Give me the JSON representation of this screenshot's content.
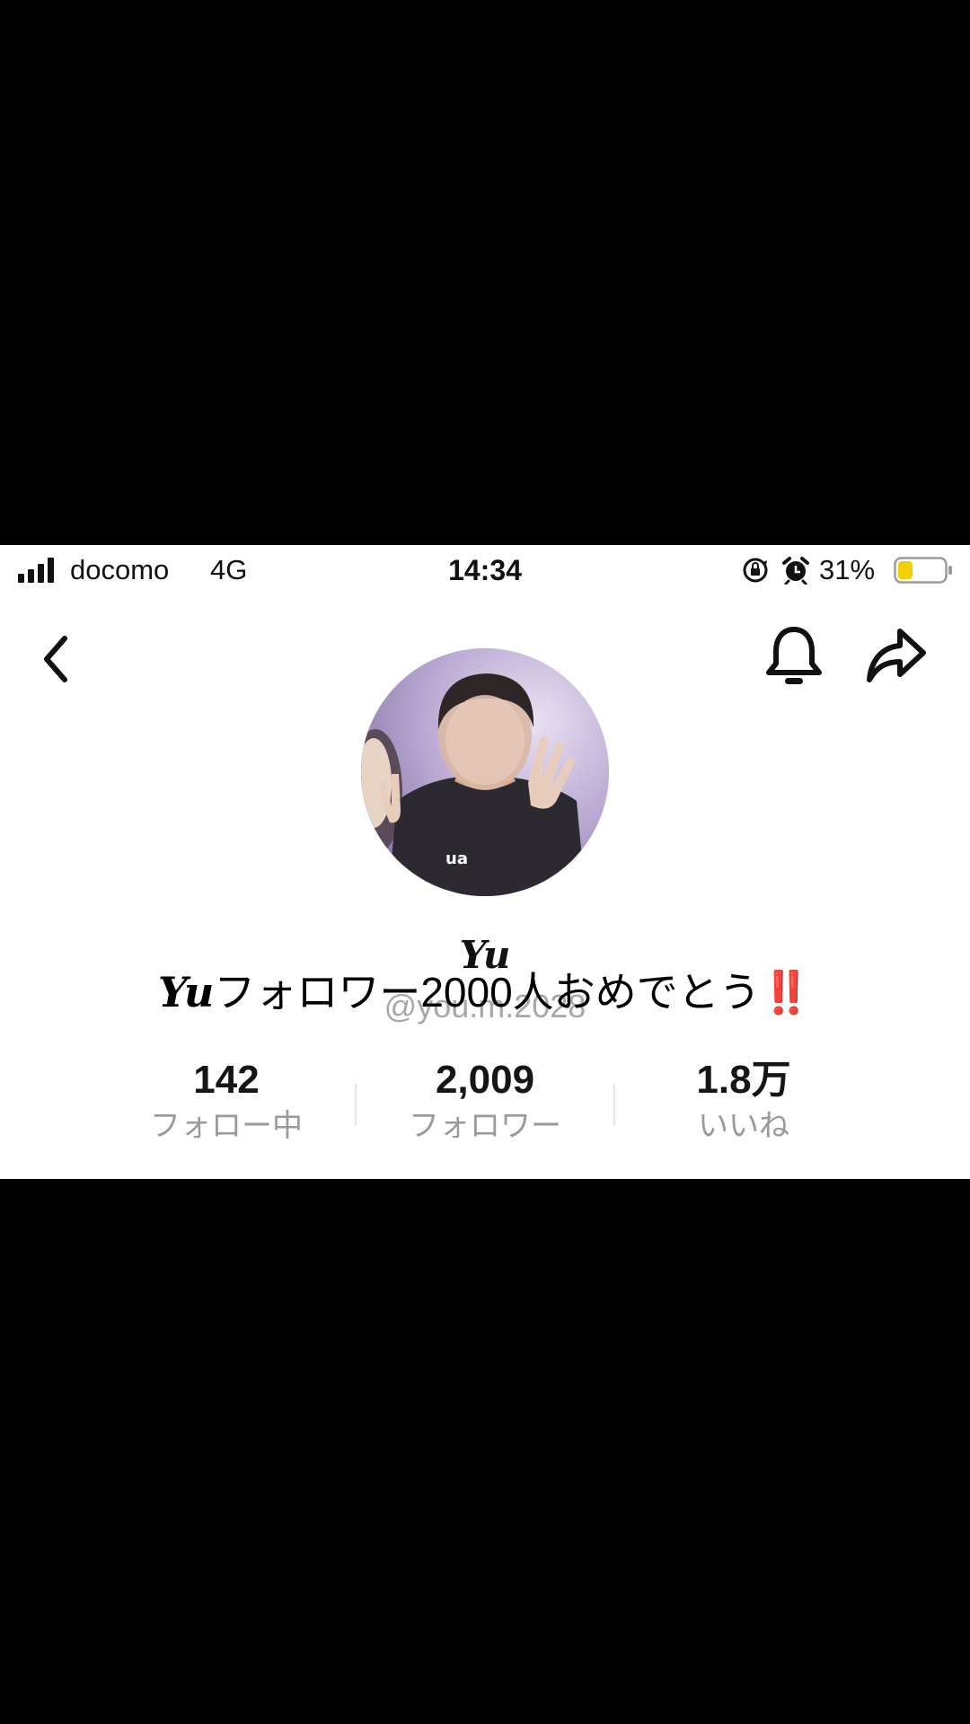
{
  "status_bar": {
    "carrier": "docomo",
    "network": "4G",
    "time": "14:34",
    "battery_percent": "31%",
    "battery_level": 0.31,
    "battery_color": "#f5d000",
    "icons": [
      "signal-icon",
      "rotation-lock-icon",
      "alarm-icon",
      "battery-icon"
    ]
  },
  "nav": {
    "icons": [
      "back-icon",
      "bell-icon",
      "share-icon"
    ]
  },
  "profile": {
    "display_name": "Yu",
    "username": "@you.m.2028"
  },
  "caption": {
    "name": "Yu",
    "text": "フォロワー2000人おめでとう",
    "mark": "‼️",
    "mark_color": "#e0141e"
  },
  "stats": [
    {
      "value": "142",
      "label": "フォロー中"
    },
    {
      "value": "2,009",
      "label": "フォロワー"
    },
    {
      "value": "1.8万",
      "label": "いいね"
    }
  ]
}
